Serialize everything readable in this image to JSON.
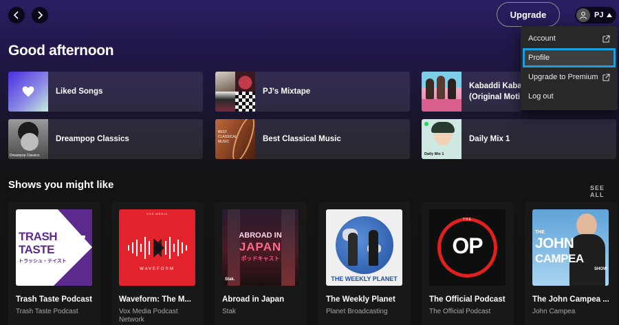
{
  "topbar": {
    "upgrade_label": "Upgrade",
    "user_initials": "PJ"
  },
  "menu": {
    "items": [
      {
        "label": "Account",
        "external": true
      },
      {
        "label": "Profile",
        "external": false,
        "active": true
      },
      {
        "label": "Upgrade to Premium",
        "external": true
      },
      {
        "label": "Log out",
        "external": false
      }
    ]
  },
  "greeting": "Good afternoon",
  "shortcuts": [
    {
      "label": "Liked Songs",
      "icon": "heart-icon"
    },
    {
      "label": "PJ's Mixtape"
    },
    {
      "label": "Kabaddi Kabaddi",
      "label2": "(Original Moti"
    },
    {
      "label": "Dreampop Classics",
      "thumb_text": "Dreampop Classics"
    },
    {
      "label": "Best Classical Music",
      "thumb_text1": "BEST",
      "thumb_text2": "CLASSICAL",
      "thumb_text3": "MUSIC"
    },
    {
      "label": "Daily Mix 1",
      "thumb_text": "Daily Mix 1"
    }
  ],
  "shows": {
    "title": "Shows you might like",
    "see_all": "SEE ALL",
    "items": [
      {
        "title": "Trash Taste Podcast",
        "subtitle": "Trash Taste Podcast",
        "art1": "TRASH",
        "art2": "TASTE",
        "art3": "トラッシュ・テイスト"
      },
      {
        "title": "Waveform: The M...",
        "subtitle": "Vox Media Podcast Network",
        "art_top": "VOX MEDIA",
        "art_bottom": "WAVEFORM"
      },
      {
        "title": "Abroad in Japan",
        "subtitle": "Stak",
        "art1": "ABROAD IN",
        "art2": "JAPAN",
        "art3": "ポッドキャスト",
        "art4": "Stak."
      },
      {
        "title": "The Weekly Planet",
        "subtitle": "Planet Broadcasting",
        "art1": "THE WEEKLY PLANET"
      },
      {
        "title": "The Official Podcast",
        "subtitle": "The Official Podcast",
        "art_top": "THE",
        "art1": "OP"
      },
      {
        "title": "The John Campea ...",
        "subtitle": "John Campea",
        "art1": "THE",
        "art2": "JOHN",
        "art3": "CAMPEA",
        "art4": "SHOW"
      }
    ]
  },
  "colors": {
    "accent_focus": "#1a9fe0",
    "trash_purple": "#5b2a8c",
    "waveform_red": "#e3232c",
    "op_red": "#e0201f"
  }
}
